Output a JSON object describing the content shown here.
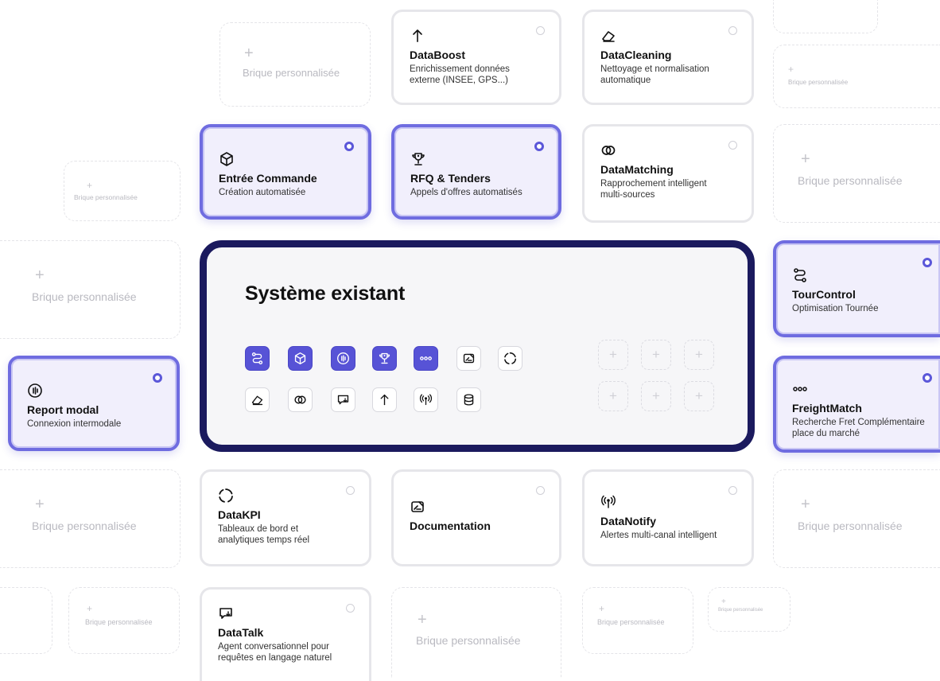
{
  "placeholder_label": "Brique personnalisée",
  "central": {
    "title": "Système existant"
  },
  "cards": {
    "databoost": {
      "title": "DataBoost",
      "subtitle": "Enrichissement données externe (INSEE, GPS...)",
      "icon": "arrow-up-icon"
    },
    "datacleaning": {
      "title": "DataCleaning",
      "subtitle": "Nettoyage et normalisation automatique",
      "icon": "eraser-icon"
    },
    "entree_commande": {
      "title": "Entrée Commande",
      "subtitle": "Création automatisée",
      "icon": "cube-icon",
      "selected": true
    },
    "rfq_tenders": {
      "title": "RFQ & Tenders",
      "subtitle": "Appels d'offres automatisés",
      "icon": "trophy-icon",
      "selected": true
    },
    "datamatching": {
      "title": "DataMatching",
      "subtitle": "Rapprochement intelligent multi-sources",
      "icon": "overlap-circles-icon"
    },
    "tourcontrol": {
      "title": "TourControl",
      "subtitle": "Optimisation Tournée",
      "icon": "route-icon",
      "selected": true
    },
    "report_modal": {
      "title": "Report modal",
      "subtitle": "Connexion intermodale",
      "icon": "signal-circle-icon",
      "selected": true
    },
    "freightmatch": {
      "title": "FreightMatch",
      "subtitle": "Recherche Fret Complémentaire place du marché",
      "icon": "dots-icon",
      "selected": true
    },
    "datakpi": {
      "title": "DataKPI",
      "subtitle": "Tableaux de bord et analytiques temps réel",
      "icon": "loading-circle-icon"
    },
    "documentation": {
      "title": "Documentation",
      "subtitle": "",
      "icon": "document-icon"
    },
    "datanotify": {
      "title": "DataNotify",
      "subtitle": "Alertes multi-canal intelligent",
      "icon": "broadcast-icon"
    },
    "datatalk": {
      "title": "DataTalk",
      "subtitle": "Agent conversationnel pour requêtes en langage naturel",
      "icon": "chat-icon"
    }
  },
  "colors": {
    "accent": "#5753d6",
    "panel_border": "#1b1a5e",
    "selected_bg": "#f1effc"
  }
}
